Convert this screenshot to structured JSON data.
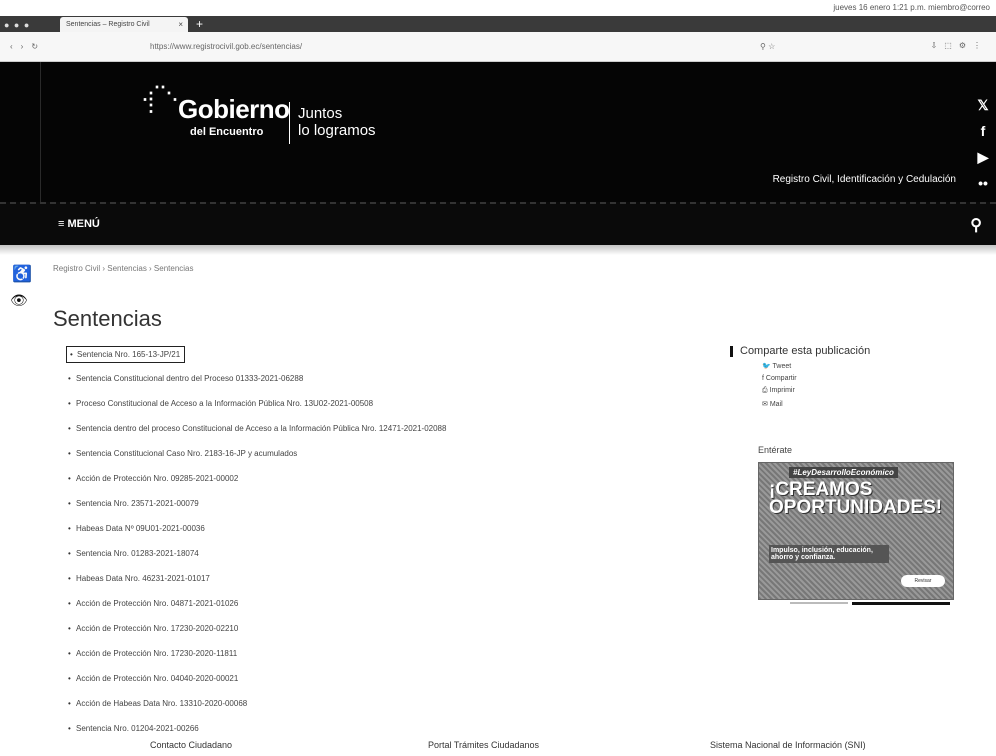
{
  "browser": {
    "tab_title": "Sentencias – Registro Civil",
    "url": "https://www.registrocivil.gob.ec/sentencias/",
    "status_right": "jueves 16 enero  1:21 p.m.   miembro@correo"
  },
  "header": {
    "logo_main": "Gobierno",
    "logo_sub": "del Encuentro",
    "slogan_line1": "Juntos",
    "slogan_line2": "lo logramos",
    "agency": "Registro Civil, Identificación y Cedulación",
    "menu_label": "≡ MENÚ"
  },
  "social": {
    "twitter": "𝕏",
    "facebook": "f",
    "youtube": "▶",
    "flickr": "••"
  },
  "breadcrumb": "Registro Civil › Sentencias › Sentencias",
  "page_title": "Sentencias",
  "documents": [
    "Sentencia Nro. 165-13-JP/21",
    "Sentencia Constitucional dentro del Proceso 01333-2021-06288",
    "Proceso Constitucional de Acceso a la Información Pública Nro. 13U02-2021-00508",
    "Sentencia dentro del proceso Constitucional de Acceso a la Información Pública Nro. 12471-2021-02088",
    "Sentencia Constitucional Caso Nro. 2183-16-JP y acumulados",
    "Acción de Protección Nro. 09285-2021-00002",
    "Sentencia Nro. 23571-2021-00079",
    "Habeas Data Nº 09U01-2021-00036",
    "Sentencia Nro. 01283-2021-18074",
    "Habeas Data Nro. 46231-2021-01017",
    "Acción de Protección Nro. 04871-2021-01026",
    "Acción de Protección Nro. 17230-2020-02210",
    "Acción de Protección Nro. 17230-2020-11811",
    "Acción de Protección Nro. 04040-2020-00021",
    "Acción de Habeas Data Nro. 13310-2020-00068",
    "Sentencia Nro. 01204-2021-00266"
  ],
  "share": {
    "title": "Comparte esta publicación",
    "tweet": "Tweet",
    "share": "Compartir",
    "print": "Imprimir",
    "mail": "Mail"
  },
  "enterate": "Entérate",
  "banner": {
    "tag": "#LeyDesarrolloEconómico",
    "headline_line1": "¡CREAMOS",
    "headline_line2": "OPORTUNIDADES!",
    "body": "Impulso, inclusión, educación, ahorro y confianza.",
    "button": "Revisar"
  },
  "footer": {
    "col1": "Contacto Ciudadano",
    "col2": "Portal Trámites Ciudadanos",
    "col3": "Sistema Nacional de Información (SNI)"
  }
}
